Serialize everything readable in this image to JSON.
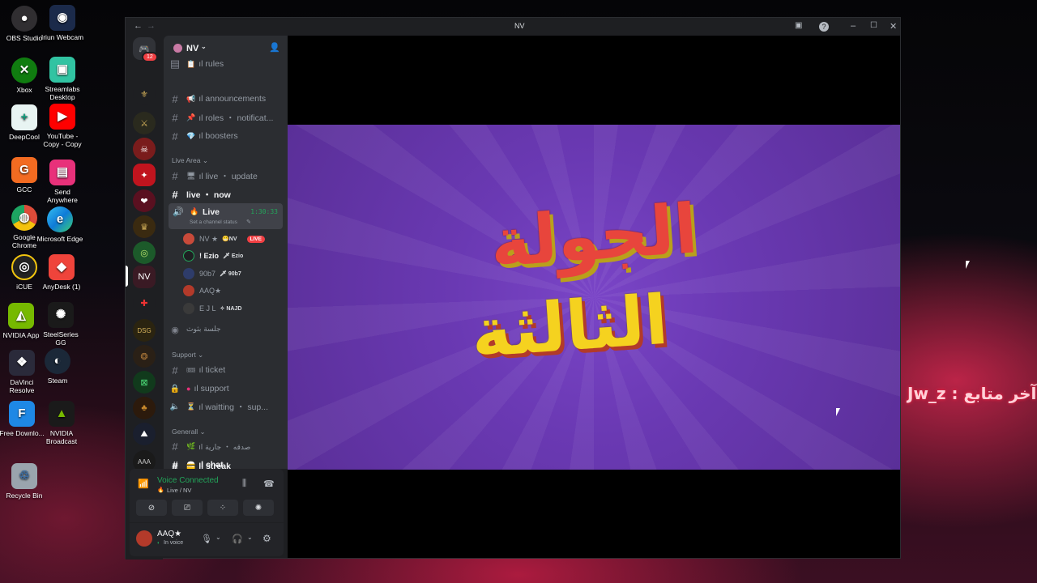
{
  "desktop": {
    "icons": [
      {
        "label": "OBS Studio",
        "color": "#302e31",
        "glyph": "●"
      },
      {
        "label": "Iriun Webcam",
        "color": "#1b2a4a",
        "glyph": "◉"
      },
      {
        "label": "Xbox",
        "color": "#107c10",
        "glyph": "✕"
      },
      {
        "label": "Streamlabs Desktop",
        "color": "#31c3a2",
        "glyph": "▣"
      },
      {
        "label": "DeepCool",
        "color": "#e8f4f2",
        "glyph": "+"
      },
      {
        "label": "YouTube - Copy - Copy",
        "color": "#ff0000",
        "glyph": "▶"
      },
      {
        "label": "GCC",
        "color": "#f26b21",
        "glyph": "G"
      },
      {
        "label": "Send Anywhere",
        "color": "#e8317a",
        "glyph": "▤"
      },
      {
        "label": "Google Chrome",
        "color": "#dd4b39",
        "glyph": "◍"
      },
      {
        "label": "Microsoft Edge",
        "color": "#0f7bd8",
        "glyph": "e"
      },
      {
        "label": "iCUE",
        "color": "#222222",
        "glyph": "◎"
      },
      {
        "label": "AnyDesk (1)",
        "color": "#ef443b",
        "glyph": "◆"
      },
      {
        "label": "NVIDIA App",
        "color": "#76b900",
        "glyph": "◭"
      },
      {
        "label": "SteelSeries GG",
        "color": "#1a1a1a",
        "glyph": "✺"
      },
      {
        "label": "DaVinci Resolve",
        "color": "#2a2a3a",
        "glyph": "❖"
      },
      {
        "label": "Steam",
        "color": "#1b2838",
        "glyph": "◐"
      },
      {
        "label": "Free Downlo...",
        "color": "#1e88e5",
        "glyph": "F"
      },
      {
        "label": "NVIDIA Broadcast",
        "color": "#1a1a1a",
        "glyph": "▲"
      },
      {
        "label": "Recycle Bin",
        "color": "#9aa4ad",
        "glyph": "♲"
      }
    ],
    "overlay_text": "Jw_z : آخر متابع"
  },
  "window": {
    "title": "NV",
    "server_badge": "12",
    "server_name": "NV",
    "channels": {
      "rules": "ıl rules",
      "announcements": "ıl announcements",
      "roles": "ıl roles ・ notificat...",
      "boosters": "ıl boosters",
      "cat_live": "Live Area",
      "live_update": "ıl live ・ update",
      "live_now": "live ・ now",
      "voice_live": "Live",
      "voice_timer": "1:30:33",
      "channel_status": "Set a channel status",
      "stage": "جلسة بثوث",
      "cat_support": "Support",
      "ticket": "ıl ticket",
      "support": "ıl support",
      "waitting": "ıl waitting ・ sup...",
      "cat_general": "Generall",
      "sadaqa": "ıl صدقه ・ جارية",
      "chat": "ıl chat",
      "streak": "ıl streak"
    },
    "voice_users": [
      {
        "name": "NV ★",
        "tag": "😁NV",
        "live": "LIVE"
      },
      {
        "name": "! Ezio",
        "tag": "🗡 Ezio"
      },
      {
        "name": "90b7",
        "tag": "🗡 90b7"
      },
      {
        "name": "AAQ★",
        "tag": ""
      },
      {
        "name": "E J L",
        "tag": "✧ NAJD"
      }
    ],
    "panel": {
      "status": "Voice Connected",
      "location": "Live / NV",
      "username": "AAQ★",
      "substatus": "In voice"
    },
    "stream": {
      "line1": "الجولة",
      "line2": "الثالثة",
      "line1_color": "#e8453c",
      "line2_color": "#f5d21f",
      "bg_color": "#6b3ab5"
    }
  }
}
